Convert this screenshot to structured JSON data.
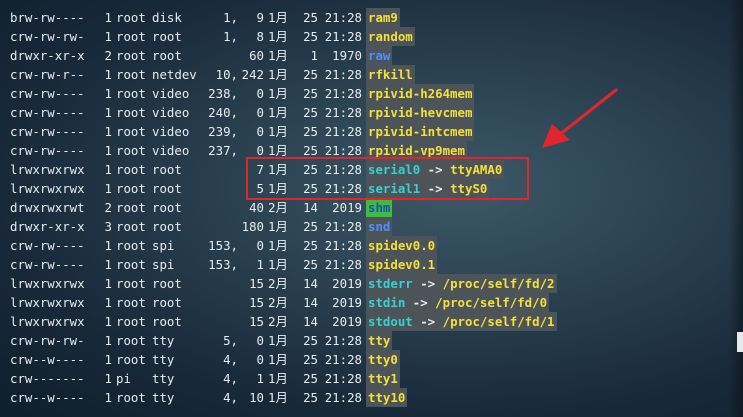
{
  "terminal": {
    "rows": [
      {
        "perm": "brw-rw----",
        "links": "1",
        "owner": "root",
        "group": "disk",
        "major": "1,",
        "minor": "9",
        "month": "1月",
        "day": "25",
        "time": "21:28",
        "name": "ram9",
        "kind": "dev",
        "arrow": "",
        "target": ""
      },
      {
        "perm": "crw-rw-rw-",
        "links": "1",
        "owner": "root",
        "group": "root",
        "major": "1,",
        "minor": "8",
        "month": "1月",
        "day": "25",
        "time": "21:28",
        "name": "random",
        "kind": "dev",
        "arrow": "",
        "target": ""
      },
      {
        "perm": "drwxr-xr-x",
        "links": "2",
        "owner": "root",
        "group": "root",
        "major": "",
        "minor": "60",
        "month": "1月",
        "day": "1",
        "time": "1970",
        "name": "raw",
        "kind": "dir",
        "arrow": "",
        "target": ""
      },
      {
        "perm": "crw-rw-r--",
        "links": "1",
        "owner": "root",
        "group": "netdev",
        "major": "10,",
        "minor": "242",
        "month": "1月",
        "day": "25",
        "time": "21:28",
        "name": "rfkill",
        "kind": "dev",
        "arrow": "",
        "target": ""
      },
      {
        "perm": "crw-rw----",
        "links": "1",
        "owner": "root",
        "group": "video",
        "major": "238,",
        "minor": "0",
        "month": "1月",
        "day": "25",
        "time": "21:28",
        "name": "rpivid-h264mem",
        "kind": "dev",
        "arrow": "",
        "target": ""
      },
      {
        "perm": "crw-rw----",
        "links": "1",
        "owner": "root",
        "group": "video",
        "major": "240,",
        "minor": "0",
        "month": "1月",
        "day": "25",
        "time": "21:28",
        "name": "rpivid-hevcmem",
        "kind": "dev",
        "arrow": "",
        "target": ""
      },
      {
        "perm": "crw-rw----",
        "links": "1",
        "owner": "root",
        "group": "video",
        "major": "239,",
        "minor": "0",
        "month": "1月",
        "day": "25",
        "time": "21:28",
        "name": "rpivid-intcmem",
        "kind": "dev",
        "arrow": "",
        "target": ""
      },
      {
        "perm": "crw-rw----",
        "links": "1",
        "owner": "root",
        "group": "video",
        "major": "237,",
        "minor": "0",
        "month": "1月",
        "day": "25",
        "time": "21:28",
        "name": "rpivid-vp9mem",
        "kind": "dev",
        "arrow": "",
        "target": ""
      },
      {
        "perm": "lrwxrwxrwx",
        "links": "1",
        "owner": "root",
        "group": "root",
        "major": "",
        "minor": "7",
        "month": "1月",
        "day": "25",
        "time": "21:28",
        "name": "serial0",
        "kind": "lnk",
        "arrow": " -> ",
        "target": "ttyAMA0"
      },
      {
        "perm": "lrwxrwxrwx",
        "links": "1",
        "owner": "root",
        "group": "root",
        "major": "",
        "minor": "5",
        "month": "1月",
        "day": "25",
        "time": "21:28",
        "name": "serial1",
        "kind": "lnk",
        "arrow": " -> ",
        "target": "ttyS0"
      },
      {
        "perm": "drwxrwxrwt",
        "links": "2",
        "owner": "root",
        "group": "root",
        "major": "",
        "minor": "40",
        "month": "2月",
        "day": "14",
        "time": "2019",
        "name": "shm",
        "kind": "shm",
        "arrow": "",
        "target": ""
      },
      {
        "perm": "drwxr-xr-x",
        "links": "3",
        "owner": "root",
        "group": "root",
        "major": "",
        "minor": "180",
        "month": "1月",
        "day": "25",
        "time": "21:28",
        "name": "snd",
        "kind": "dir",
        "arrow": "",
        "target": ""
      },
      {
        "perm": "crw-rw----",
        "links": "1",
        "owner": "root",
        "group": "spi",
        "major": "153,",
        "minor": "0",
        "month": "1月",
        "day": "25",
        "time": "21:28",
        "name": "spidev0.0",
        "kind": "dev",
        "arrow": "",
        "target": ""
      },
      {
        "perm": "crw-rw----",
        "links": "1",
        "owner": "root",
        "group": "spi",
        "major": "153,",
        "minor": "1",
        "month": "1月",
        "day": "25",
        "time": "21:28",
        "name": "spidev0.1",
        "kind": "dev",
        "arrow": "",
        "target": ""
      },
      {
        "perm": "lrwxrwxrwx",
        "links": "1",
        "owner": "root",
        "group": "root",
        "major": "",
        "minor": "15",
        "month": "2月",
        "day": "14",
        "time": "2019",
        "name": "stderr",
        "kind": "lnk",
        "arrow": " -> ",
        "target": "/proc/self/fd/2"
      },
      {
        "perm": "lrwxrwxrwx",
        "links": "1",
        "owner": "root",
        "group": "root",
        "major": "",
        "minor": "15",
        "month": "2月",
        "day": "14",
        "time": "2019",
        "name": "stdin",
        "kind": "lnk",
        "arrow": " -> ",
        "target": "/proc/self/fd/0"
      },
      {
        "perm": "lrwxrwxrwx",
        "links": "1",
        "owner": "root",
        "group": "root",
        "major": "",
        "minor": "15",
        "month": "2月",
        "day": "14",
        "time": "2019",
        "name": "stdout",
        "kind": "lnk",
        "arrow": " -> ",
        "target": "/proc/self/fd/1"
      },
      {
        "perm": "crw-rw-rw-",
        "links": "1",
        "owner": "root",
        "group": "tty",
        "major": "5,",
        "minor": "0",
        "month": "1月",
        "day": "25",
        "time": "21:28",
        "name": "tty",
        "kind": "dev",
        "arrow": "",
        "target": ""
      },
      {
        "perm": "crw--w----",
        "links": "1",
        "owner": "root",
        "group": "tty",
        "major": "4,",
        "minor": "0",
        "month": "1月",
        "day": "25",
        "time": "21:28",
        "name": "tty0",
        "kind": "dev",
        "arrow": "",
        "target": ""
      },
      {
        "perm": "crw-------",
        "links": "1",
        "owner": "pi",
        "group": "tty",
        "major": "4,",
        "minor": "1",
        "month": "1月",
        "day": "25",
        "time": "21:28",
        "name": "tty1",
        "kind": "dev",
        "arrow": "",
        "target": ""
      },
      {
        "perm": "crw--w----",
        "links": "1",
        "owner": "root",
        "group": "tty",
        "major": "4,",
        "minor": "10",
        "month": "1月",
        "day": "25",
        "time": "21:28",
        "name": "tty10",
        "kind": "dev",
        "arrow": "",
        "target": ""
      }
    ]
  },
  "annotation": {
    "box_color": "#e0262c",
    "arrow_color": "#e0262c",
    "highlighted_rows": [
      "serial0",
      "serial1"
    ]
  },
  "colors": {
    "device": "#f4e03a",
    "directory": "#4c8fff",
    "symlink": "#34d2d2",
    "shm_background": "#3bbf3b",
    "name_background": "#4d5459"
  }
}
